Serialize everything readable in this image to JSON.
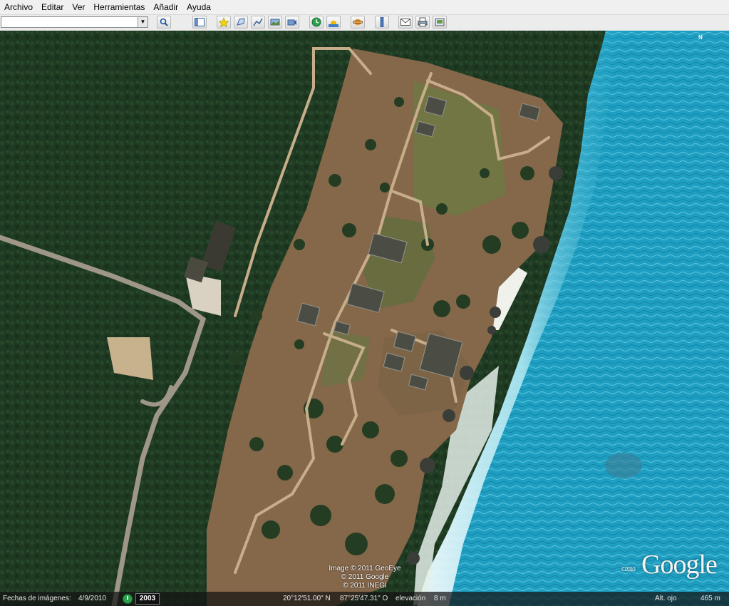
{
  "menu": [
    "Archivo",
    "Editar",
    "Ver",
    "Herramientas",
    "Añadir",
    "Ayuda"
  ],
  "search": {
    "value": "",
    "placeholder": ""
  },
  "toolbar_icons": [
    "search-icon",
    "sidebar-toggle-icon",
    "add-placemark-icon",
    "add-polygon-icon",
    "add-path-icon",
    "add-image-overlay-icon",
    "record-tour-icon",
    "historical-imagery-icon",
    "sunlight-icon",
    "planets-icon",
    "ruler-icon",
    "email-icon",
    "print-icon",
    "save-image-icon"
  ],
  "compass": {
    "north_label": "N"
  },
  "copyright": [
    "Image © 2011 GeoEye",
    "© 2011 Google",
    "© 2011 INEGI"
  ],
  "logo": {
    "text": "Google",
    "year": "©2010"
  },
  "status": {
    "imagery_date_label": "Fechas de imágenes:",
    "imagery_date": "4/9/2010",
    "historical_year": "2003",
    "latitude": "20°12'51.00\" N",
    "longitude": "87°25'47.31\" O",
    "elevation_label": "elevación",
    "elevation": "8 m",
    "eye_alt_label": "Alt. ojo",
    "eye_alt": "465 m"
  },
  "colors": {
    "sea": "#1ea3c4",
    "forest": "#1f3a22",
    "clearing": "#8a6a4c",
    "beach": "#f2f2ee"
  }
}
